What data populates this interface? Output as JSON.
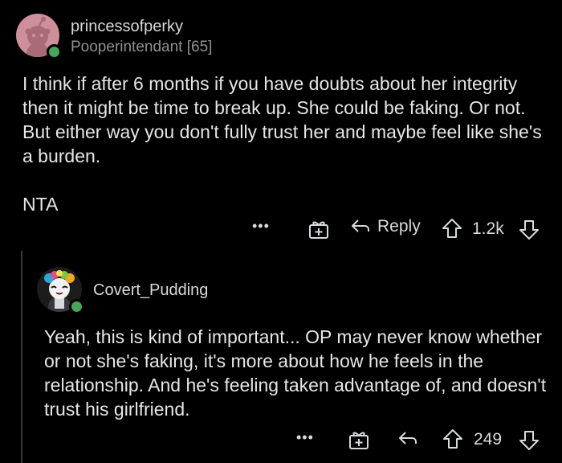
{
  "comment": {
    "username": "princessofperky",
    "flair": "Pooperintendant [65]",
    "paragraphs": [
      "I think if after 6 months if you have doubts about her integrity then it might be time to break up. She could be faking. Or not. But either way you don't fully trust her and maybe feel like she's a burden.",
      "NTA"
    ],
    "reply_label": "Reply",
    "score": "1.2k",
    "more_label": "•••"
  },
  "reply": {
    "username": "Covert_Pudding",
    "text": "Yeah, this is kind of important... OP may never know whether or not she's faking, it's more about how he feels in the relationship. And he's feeling taken advantage of, and doesn't trust his girlfriend.",
    "score": "249",
    "more_label": "•••"
  },
  "colors": {
    "background": "#000000",
    "text": "#d7dadc",
    "muted": "#8e9194",
    "online": "#46a758",
    "avatar_pink": "#ce8f9a"
  },
  "icons": [
    "avatar-icon",
    "online-indicator",
    "more-icon",
    "gift-award-icon",
    "reply-arrow-icon",
    "upvote-icon",
    "downvote-icon"
  ]
}
